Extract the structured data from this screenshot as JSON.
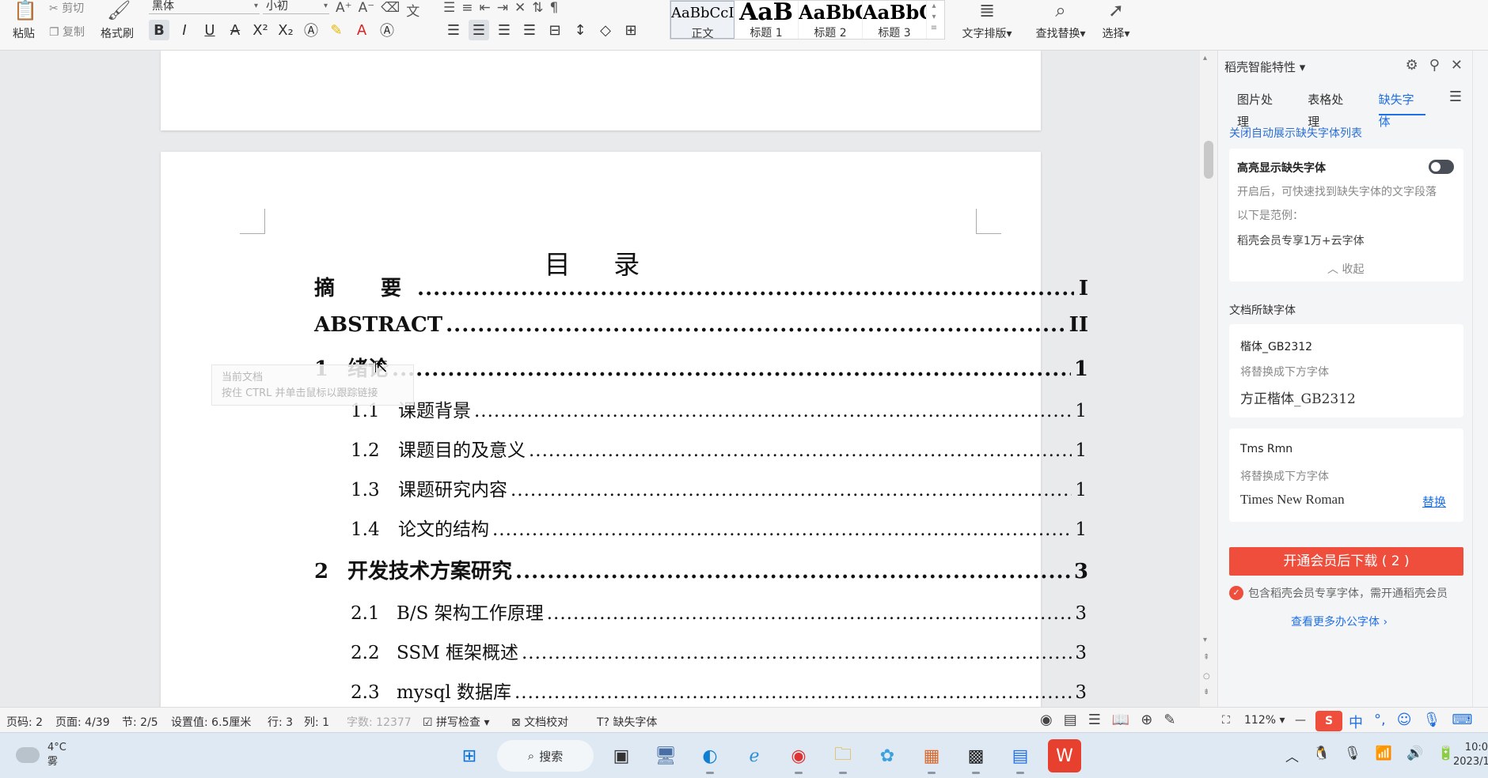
{
  "ribbon": {
    "paste": "粘贴",
    "cut": "剪切",
    "copy": "复制",
    "format_painter": "格式刷",
    "font_name": "黑体",
    "font_size": "小初",
    "styles": [
      {
        "preview": "AaBbCcI",
        "caption": "正文"
      },
      {
        "preview": "AaB",
        "caption": "标题 1"
      },
      {
        "preview": "AaBbC",
        "caption": "标题 2"
      },
      {
        "preview": "AaBbC",
        "caption": "标题 3"
      }
    ],
    "text_layout": "文字排版",
    "find_replace": "查找替换",
    "select": "选择"
  },
  "document": {
    "toc_title": "目 录",
    "toc": [
      {
        "num": "",
        "title": "摘　要",
        "page": "I",
        "level": 1
      },
      {
        "num": "",
        "title": "ABSTRACT",
        "page": "II",
        "level": 1
      },
      {
        "num": "1",
        "title": "绪论",
        "page": "1",
        "level": 1
      },
      {
        "num": "1.1",
        "title": "课题背景",
        "page": "1",
        "level": 2
      },
      {
        "num": "1.2",
        "title": "课题目的及意义",
        "page": "1",
        "level": 2
      },
      {
        "num": "1.3",
        "title": "课题研究内容",
        "page": "1",
        "level": 2
      },
      {
        "num": "1.4",
        "title": "论文的结构",
        "page": "1",
        "level": 2
      },
      {
        "num": "2",
        "title": "开发技术方案研究",
        "page": "3",
        "level": 1
      },
      {
        "num": "2.1",
        "title": "B/S 架构工作原理",
        "page": "3",
        "level": 2
      },
      {
        "num": "2.2",
        "title": "SSM 框架概述",
        "page": "3",
        "level": 2
      },
      {
        "num": "2.3",
        "title": "mysql 数据库",
        "page": "3",
        "level": 2
      }
    ],
    "hover_tip_line1": "当前文档",
    "hover_tip_line2": "按住 CTRL 并单击鼠标以跟踪链接"
  },
  "panel": {
    "title": "稻壳智能特性",
    "tabs": [
      "图片处理",
      "表格处理",
      "缺失字体"
    ],
    "active_tab": "缺失字体",
    "close_auto_link": "关闭自动展示缺失字体列表",
    "highlight_title": "高亮显示缺失字体",
    "highlight_desc": "开启后，可快速找到缺失字体的文字段落",
    "example_label": "以下是范例：",
    "example_text": "稻壳会员专享1万+云字体",
    "collapse": "收起",
    "missing_section": "文档所缺字体",
    "fonts": [
      {
        "missing": "楷体_GB2312",
        "replace_hint": "将替换成下方字体",
        "replacement": "方正楷体_GB2312",
        "action": ""
      },
      {
        "missing": "Tms Rmn",
        "replace_hint": "将替换成下方字体",
        "replacement": "Times New Roman",
        "action": "替换"
      }
    ],
    "vip_button": "开通会员后下载 ( 2 )",
    "vip_note": "包含稻壳会员专享字体，需开通稻壳会员",
    "more_fonts": "查看更多办公字体"
  },
  "status": {
    "page_no": "页码: 2",
    "pages": "页面: 4/39",
    "section": "节: 2/5",
    "setting": "设置值: 6.5厘米",
    "row": "行: 3",
    "col": "列: 1",
    "word_count": "字数: 12377",
    "spell_check": "拼写检查",
    "doc_proof": "文档校对",
    "missing_font": "缺失字体",
    "zoom": "112%"
  },
  "taskbar": {
    "temp": "4°C",
    "weather": "雾",
    "search": "搜索",
    "time": "10:0",
    "date": "2023/1"
  }
}
